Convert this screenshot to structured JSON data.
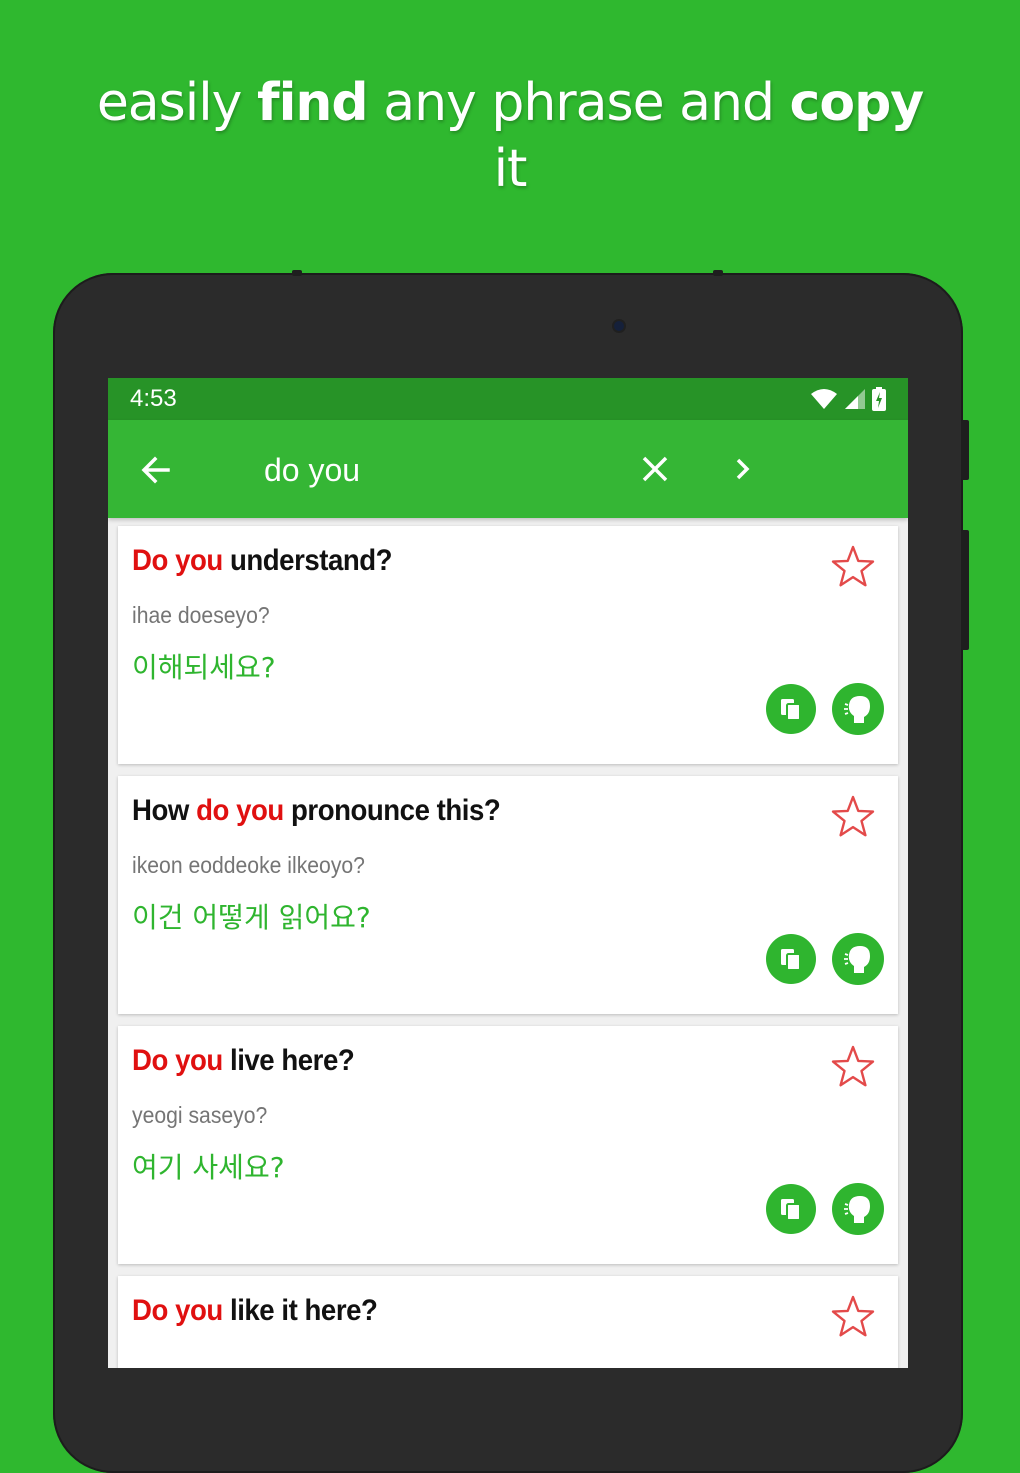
{
  "promo": {
    "segments": [
      {
        "text": "easily ",
        "bold": false
      },
      {
        "text": "find",
        "bold": true
      },
      {
        "text": " any phrase and ",
        "bold": false
      },
      {
        "text": "copy",
        "bold": true
      }
    ],
    "line2": "it"
  },
  "status_bar": {
    "time": "4:53",
    "icons": [
      "wifi-icon",
      "signal-icon",
      "battery-icon"
    ]
  },
  "app_bar": {
    "search_value": "do you",
    "back_icon": "arrow-left-icon",
    "clear_icon": "close-icon",
    "next_icon": "chevron-right-icon"
  },
  "results": [
    {
      "phrase_parts": [
        {
          "text": "Do you",
          "highlight": true
        },
        {
          "text": " understand?",
          "highlight": false
        }
      ],
      "romanized": "ihae doeseyo?",
      "korean": "이해되세요?"
    },
    {
      "phrase_parts": [
        {
          "text": "How ",
          "highlight": false
        },
        {
          "text": "do you",
          "highlight": true
        },
        {
          "text": " pronounce this?",
          "highlight": false
        }
      ],
      "romanized": "ikeon eoddeoke ilkeoyo?",
      "korean": "이건 어떻게 읽어요?"
    },
    {
      "phrase_parts": [
        {
          "text": "Do you",
          "highlight": true
        },
        {
          "text": " live here?",
          "highlight": false
        }
      ],
      "romanized": "yeogi saseyo?",
      "korean": "여기 사세요?"
    },
    {
      "phrase_parts": [
        {
          "text": "Do you",
          "highlight": true
        },
        {
          "text": " like it here?",
          "highlight": false
        }
      ],
      "romanized": "",
      "korean": ""
    }
  ],
  "colors": {
    "background": "#2fb82f",
    "app_bar": "#35b635",
    "status_bar": "#279327",
    "highlight": "#e01010",
    "korean_text": "#2fb52f",
    "star_outline": "#e34a4a"
  }
}
